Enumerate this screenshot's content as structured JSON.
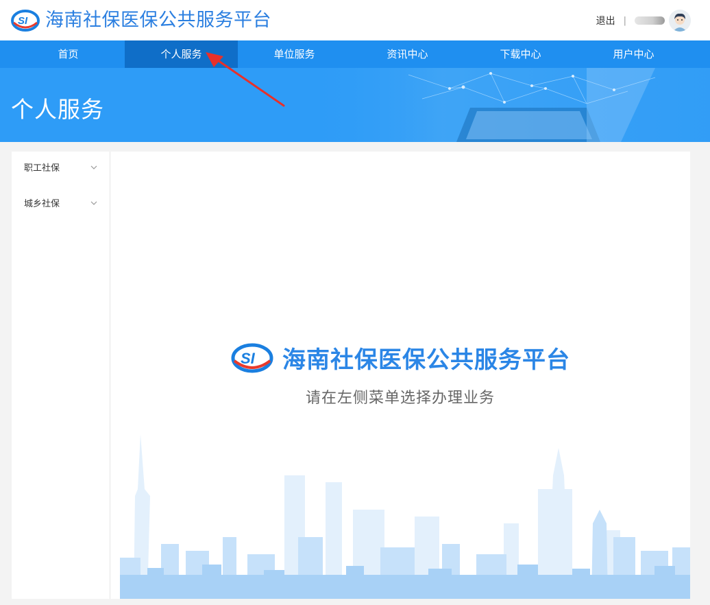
{
  "header": {
    "title": "海南社保医保公共服务平台",
    "logo_icon": "si-logo-icon",
    "logout": "退出",
    "separator": "|",
    "avatar_icon": "user-avatar-icon"
  },
  "nav": {
    "items": [
      "首页",
      "个人服务",
      "单位服务",
      "资讯中心",
      "下载中心",
      "用户中心"
    ],
    "active_index": 1
  },
  "banner": {
    "title": "个人服务"
  },
  "sidebar": {
    "items": [
      "职工社保",
      "城乡社保"
    ]
  },
  "content": {
    "title": "海南社保医保公共服务平台",
    "subtitle": "请在左侧菜单选择办理业务"
  },
  "colors": {
    "brand": "#2b7fe0",
    "nav_bg": "#1f8ff0",
    "nav_active": "#0f6ec8",
    "banner_bg": "#2e9cf7",
    "annotation_arrow": "#e8302a"
  }
}
